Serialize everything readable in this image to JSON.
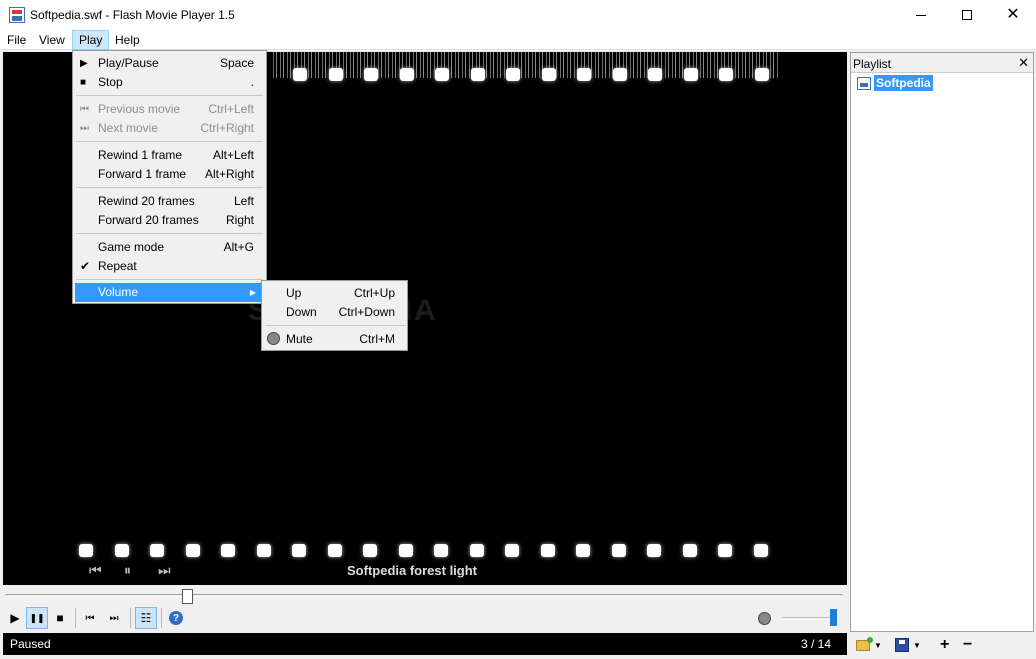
{
  "window": {
    "title": "Softpedia.swf - Flash Movie Player 1.5",
    "min_icon": "minimize-icon",
    "max_icon": "maximize-icon",
    "close_glyph": "✕"
  },
  "menubar": {
    "file": "File",
    "view": "View",
    "play": "Play",
    "help": "Help"
  },
  "play_menu": {
    "items": [
      {
        "label": "Play/Pause",
        "shortcut": "Space",
        "icon": "play-icon",
        "glyph": "▶"
      },
      {
        "label": "Stop",
        "shortcut": ".",
        "icon": "stop-icon",
        "glyph": "■"
      },
      {
        "label": "Previous movie",
        "shortcut": "Ctrl+Left",
        "icon": "previous-icon",
        "glyph": "⏮",
        "disabled": true
      },
      {
        "label": "Next movie",
        "shortcut": "Ctrl+Right",
        "icon": "next-icon",
        "glyph": "⏭",
        "disabled": true
      },
      {
        "label": "Rewind 1 frame",
        "shortcut": "Alt+Left"
      },
      {
        "label": "Forward 1 frame",
        "shortcut": "Alt+Right"
      },
      {
        "label": "Rewind 20 frames",
        "shortcut": "Left"
      },
      {
        "label": "Forward 20 frames",
        "shortcut": "Right"
      },
      {
        "label": "Game mode",
        "shortcut": "Alt+G"
      },
      {
        "label": "Repeat",
        "glyph": "✔",
        "checked": true
      },
      {
        "label": "Volume",
        "submenu_glyph": "▶"
      }
    ]
  },
  "volume_menu": {
    "items": [
      {
        "label": "Up",
        "shortcut": "Ctrl+Up"
      },
      {
        "label": "Down",
        "shortcut": "Ctrl+Down"
      },
      {
        "label": "Mute",
        "shortcut": "Ctrl+M",
        "icon": "speaker-icon"
      }
    ]
  },
  "video": {
    "watermark": "SOFTPEDIA",
    "movie_title": "Softpedia forest light",
    "prev_glyph": "⏮",
    "pause_glyph": "⏸",
    "next_glyph": "⏭"
  },
  "controls": {
    "play_glyph": "▶",
    "pause_glyph": "❚❚",
    "stop_glyph": "■",
    "prev_glyph": "⏮",
    "next_glyph": "⏭",
    "playlist_glyph": "☷",
    "help_glyph": "?",
    "volume_fraction": 1.0
  },
  "status": {
    "state": "Paused",
    "count": "3 / 14"
  },
  "playlist": {
    "title": "Playlist",
    "close_glyph": "✕",
    "items": [
      "Softpedia"
    ],
    "add_glyph": "+",
    "remove_glyph": "−",
    "dropdown_glyph": "▼"
  },
  "colors": {
    "accent": "#3399ff",
    "menu_highlight": "#cce8ff",
    "video_bg": "#000000"
  }
}
